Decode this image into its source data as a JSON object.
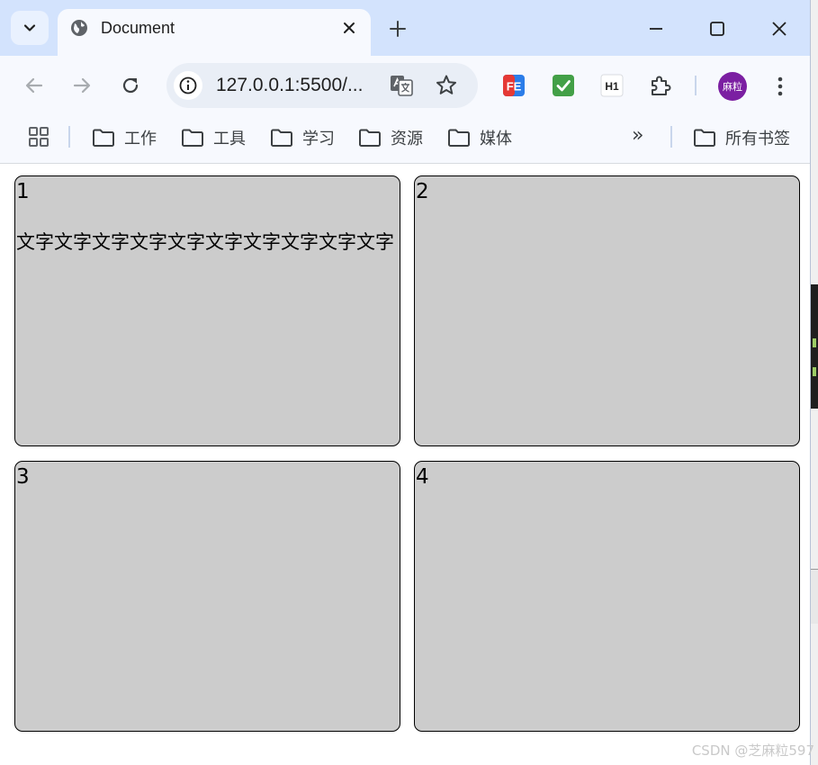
{
  "browser": {
    "tab": {
      "title": "Document"
    },
    "address_bar": {
      "url": "127.0.0.1:5500/..."
    },
    "profile": {
      "avatar_text": "麻粒",
      "color": "#7b1fa2"
    },
    "extensions": [
      {
        "name": "fe-icon",
        "label": "FE"
      },
      {
        "name": "check-icon",
        "label": ""
      },
      {
        "name": "h1-icon",
        "label": "H1"
      },
      {
        "name": "puzzle-icon",
        "label": ""
      }
    ],
    "bookmarks": {
      "folders": [
        "工作",
        "工具",
        "学习",
        "资源",
        "媒体"
      ],
      "overflow": "»",
      "all_bookmarks": "所有书签"
    },
    "colors": {
      "tabstrip": "#d3e3fd",
      "toolbar": "#f7f9fe"
    }
  },
  "page": {
    "boxes": [
      {
        "number": "1",
        "text": "文字文字文字文字文字文字文字文字文字文字"
      },
      {
        "number": "2",
        "text": ""
      },
      {
        "number": "3",
        "text": ""
      },
      {
        "number": "4",
        "text": ""
      }
    ],
    "box_color": "#cccccc"
  },
  "watermark": "CSDN @芝麻粒597"
}
